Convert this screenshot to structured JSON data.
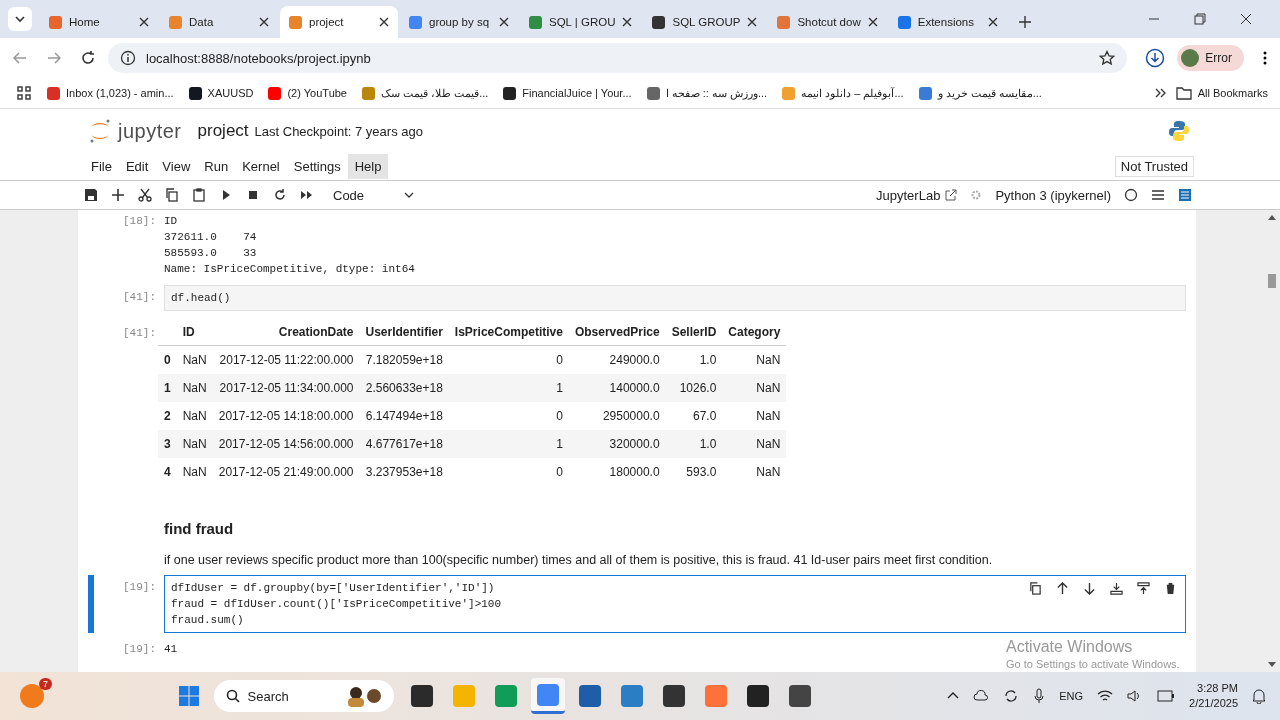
{
  "browser": {
    "tabs": [
      {
        "title": "Home",
        "selected": false,
        "color": "#e8652c"
      },
      {
        "title": "Data",
        "selected": false,
        "color": "#e8852c"
      },
      {
        "title": "project",
        "selected": true,
        "color": "#e8852c"
      },
      {
        "title": "group by sq",
        "selected": false,
        "color": "#4285f4"
      },
      {
        "title": "SQL | GROU",
        "selected": false,
        "color": "#2f8d46"
      },
      {
        "title": "SQL GROUP",
        "selected": false,
        "color": "#333333"
      },
      {
        "title": "Shotcut dow",
        "selected": false,
        "color": "#e0743a"
      },
      {
        "title": "Extensions",
        "selected": false,
        "color": "#1a73e8"
      }
    ],
    "url": "localhost:8888/notebooks/project.ipynb",
    "profile": "Error",
    "bookmarks": [
      {
        "label": "Inbox (1,023) - amin...",
        "color": "#d93025"
      },
      {
        "label": "XAUUSD",
        "color": "#131722"
      },
      {
        "label": "(2) YouTube",
        "color": "#ff0000"
      },
      {
        "label": "قیمت طلا، قیمت سک...",
        "color": "#b8860b"
      },
      {
        "label": "FinancialJuice | Your...",
        "color": "#222222"
      },
      {
        "label": "ورزش سه :: صفحه ا...",
        "color": "#666666"
      },
      {
        "label": "آبوفیلم – دانلود انیمه...",
        "color": "#f0a030"
      },
      {
        "label": "مقایسه قیمت خرید و...",
        "color": "#3a7bd5"
      }
    ],
    "all_bookmarks": "All Bookmarks"
  },
  "jupyter": {
    "logo": "jupyter",
    "notebook": "project",
    "checkpoint": "Last Checkpoint: 7 years ago",
    "menu": [
      {
        "label": "File",
        "selected": false
      },
      {
        "label": "Edit",
        "selected": false
      },
      {
        "label": "View",
        "selected": false
      },
      {
        "label": "Run",
        "selected": false
      },
      {
        "label": "Kernel",
        "selected": false
      },
      {
        "label": "Settings",
        "selected": false
      },
      {
        "label": "Help",
        "selected": true
      }
    ],
    "trust": "Not Trusted",
    "cell_type": "Code",
    "lab_link": "JupyterLab",
    "kernel": "Python 3 (ipykernel)"
  },
  "cells": [
    {
      "kind": "output",
      "prompt": "[18]:",
      "lines": [
        "ID",
        "372611.0    74",
        "585593.0    33",
        "Name: IsPriceCompetitive, dtype: int64"
      ]
    },
    {
      "kind": "code",
      "prompt": "[41]:",
      "active": false,
      "lines": [
        "df.head()"
      ]
    },
    {
      "kind": "table",
      "prompt": "[41]:",
      "columns": [
        "",
        "ID",
        "CreationDate",
        "UserIdentifier",
        "IsPriceCompetitive",
        "ObservedPrice",
        "SellerID",
        "Category"
      ],
      "rows": [
        [
          "0",
          "NaN",
          "2017-12-05 11:22:00.000",
          "7.182059e+18",
          "0",
          "249000.0",
          "1.0",
          "NaN"
        ],
        [
          "1",
          "NaN",
          "2017-12-05 11:34:00.000",
          "2.560633e+18",
          "1",
          "140000.0",
          "1026.0",
          "NaN"
        ],
        [
          "2",
          "NaN",
          "2017-12-05 14:18:00.000",
          "6.147494e+18",
          "0",
          "2950000.0",
          "67.0",
          "NaN"
        ],
        [
          "3",
          "NaN",
          "2017-12-05 14:56:00.000",
          "4.677617e+18",
          "1",
          "320000.0",
          "1.0",
          "NaN"
        ],
        [
          "4",
          "NaN",
          "2017-12-05 21:49:00.000",
          "3.237953e+18",
          "0",
          "180000.0",
          "593.0",
          "NaN"
        ]
      ]
    },
    {
      "kind": "markdown",
      "heading": "find fraud",
      "text": "if one user reviews specific product more than 100(specific number) times and all of them is positive, this is fraud. 41 Id-user pairs meet first condition."
    },
    {
      "kind": "code",
      "prompt": "[19]:",
      "active": true,
      "lines": [
        "dfIdUser = df.groupby(by=['UserIdentifier','ID'])",
        "fraud = dfIdUser.count()['IsPriceCompetitive']>100",
        "fraud.sum()"
      ]
    },
    {
      "kind": "output",
      "prompt": "[19]:",
      "lines": [
        "41"
      ]
    }
  ],
  "activation": {
    "title": "Activate Windows",
    "hint": "Go to Settings to activate Windows."
  },
  "taskbar": {
    "badge": "7",
    "search": {
      "placeholder": "Search"
    },
    "apps": [
      {
        "color": "#2b2b2b",
        "selected": false
      },
      {
        "color": "#f4b400",
        "selected": false
      },
      {
        "color": "#0f9d58",
        "selected": false
      },
      {
        "color": "#4285f4",
        "selected": true
      },
      {
        "color": "#1e5ea8",
        "selected": false
      },
      {
        "color": "#2a7fc4",
        "selected": false
      },
      {
        "color": "#333333",
        "selected": false
      },
      {
        "color": "#ff7139",
        "selected": false
      },
      {
        "color": "#222222",
        "selected": false
      },
      {
        "color": "#444444",
        "selected": false
      }
    ],
    "language": "ENG",
    "time": "3:28 PM",
    "date": "2/21/2025"
  }
}
